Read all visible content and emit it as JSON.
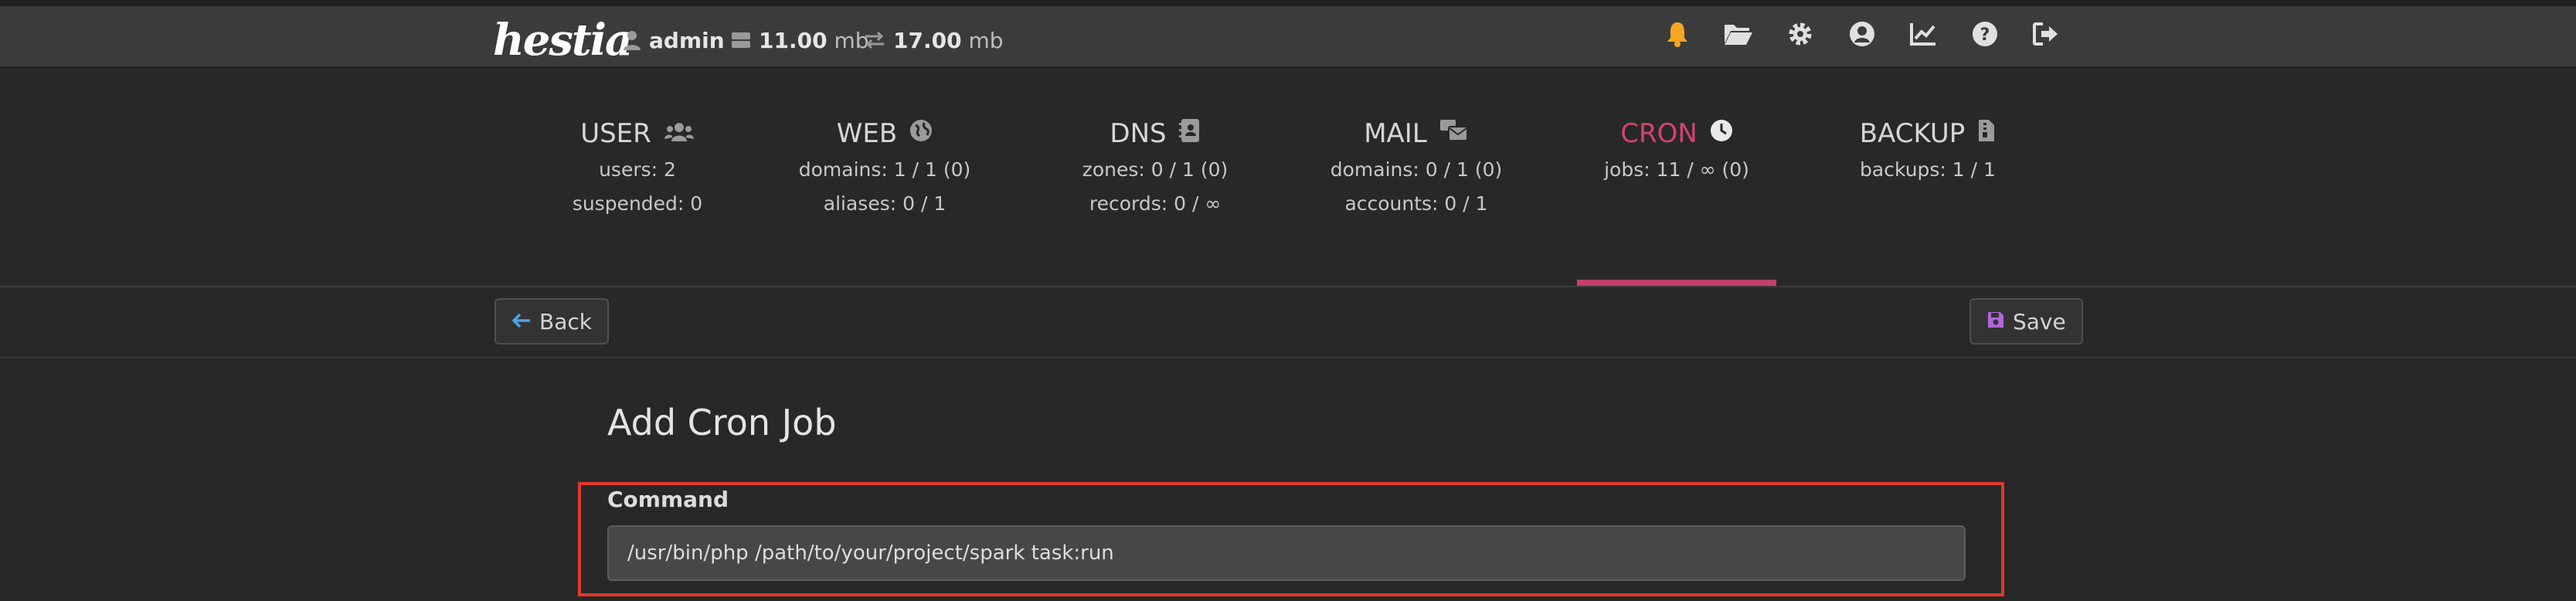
{
  "app": {
    "logo": "hestia"
  },
  "header": {
    "user": "admin",
    "disk_value": "11.00",
    "disk_unit": "mb",
    "bandwidth_value": "17.00",
    "bandwidth_unit": "mb",
    "icons": [
      "bell-icon",
      "folder-icon",
      "gear-icon",
      "user-circle-icon",
      "chart-icon",
      "help-icon",
      "logout-icon"
    ],
    "colors": {
      "bell": "#f5a623",
      "accent": "#c2406a"
    }
  },
  "tabs": [
    {
      "title": "USER",
      "icon": "users-icon",
      "lines": [
        "users: 2",
        "suspended: 0"
      ]
    },
    {
      "title": "WEB",
      "icon": "globe-icon",
      "lines": [
        "domains: 1 / 1 (0)",
        "aliases: 0 / 1"
      ]
    },
    {
      "title": "DNS",
      "icon": "address-book-icon",
      "lines": [
        "zones: 0 / 1 (0)",
        "records: 0 / ∞"
      ]
    },
    {
      "title": "MAIL",
      "icon": "mail-bulk-icon",
      "lines": [
        "domains: 0 / 1 (0)",
        "accounts: 0 / 1"
      ]
    },
    {
      "title": "CRON",
      "icon": "clock-icon",
      "lines": [
        "jobs: 11 / ∞ (0)"
      ],
      "active": true
    },
    {
      "title": "BACKUP",
      "icon": "file-archive-icon",
      "lines": [
        "backups: 1 / 1"
      ]
    }
  ],
  "toolbar": {
    "back_label": "Back",
    "save_label": "Save"
  },
  "form": {
    "heading": "Add Cron Job",
    "command_label": "Command",
    "command_value": "/usr/bin/php /path/to/your/project/spark task:run"
  }
}
